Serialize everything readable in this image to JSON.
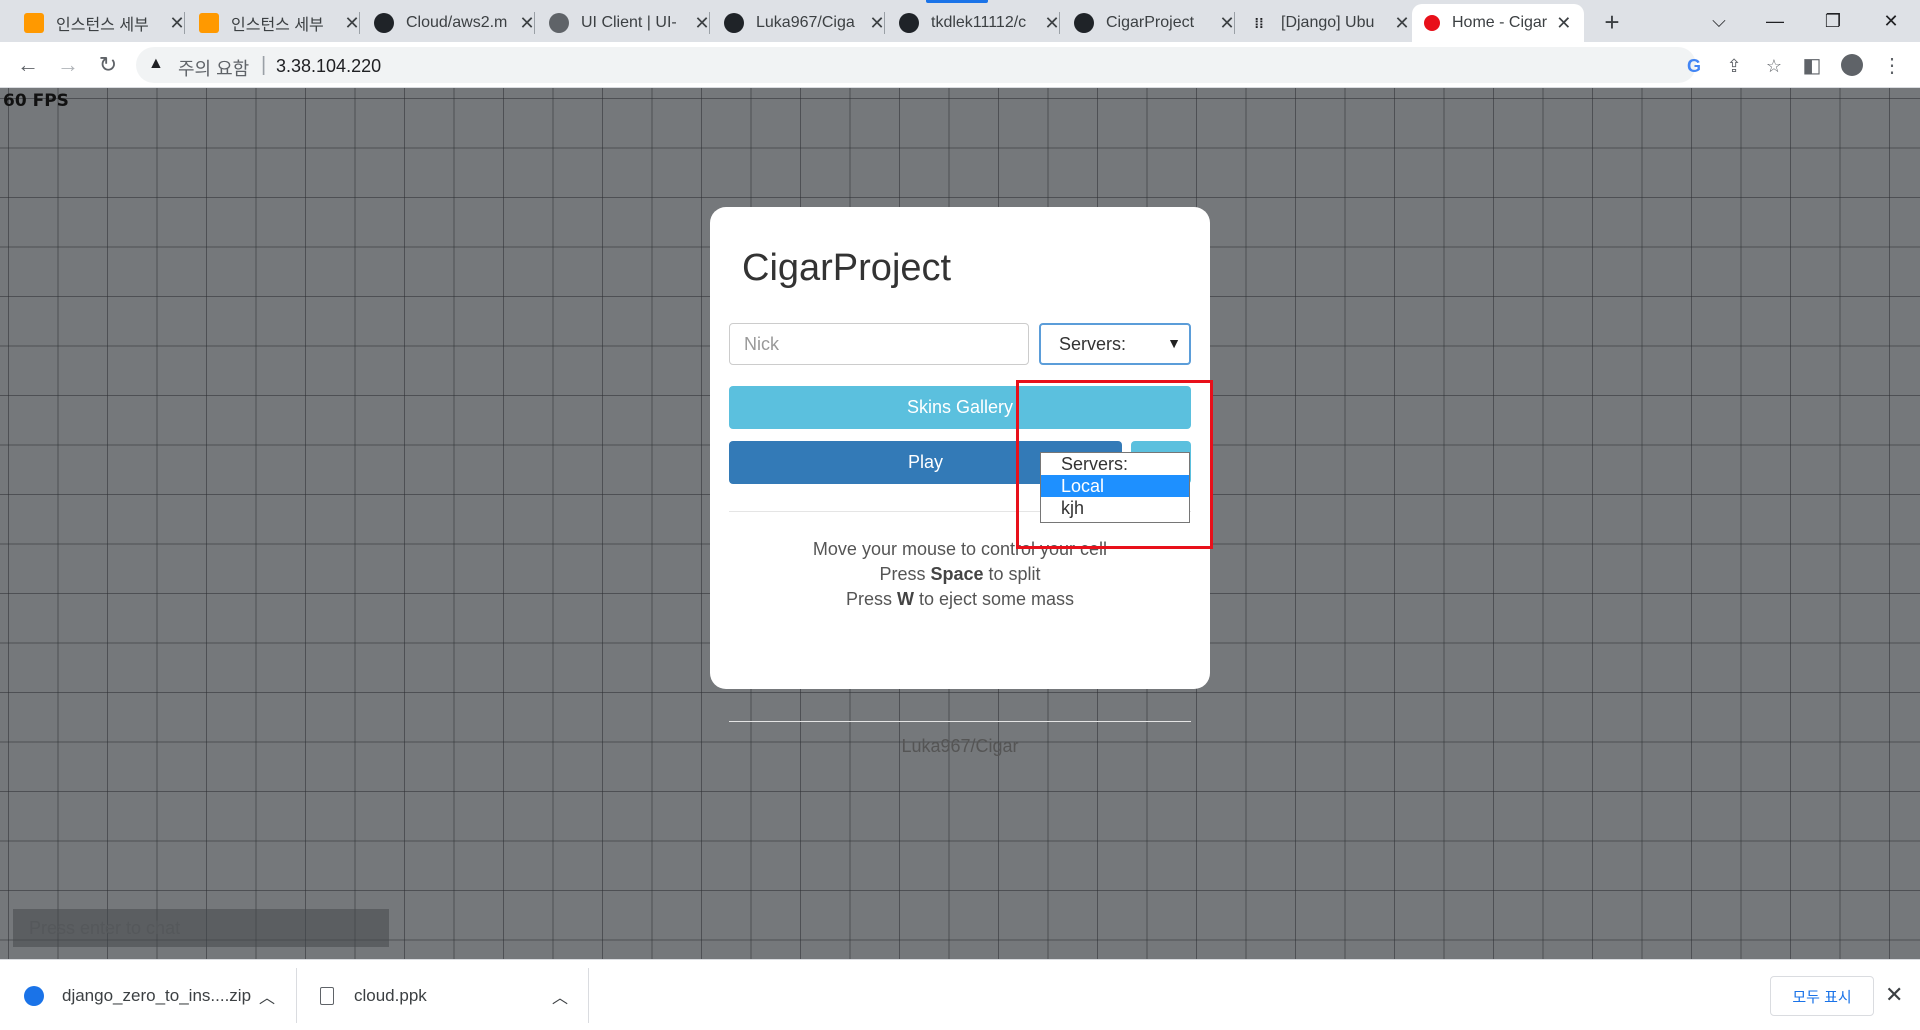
{
  "browser": {
    "tabs": [
      {
        "title": "인스턴스 세부",
        "icon": "aws-icon"
      },
      {
        "title": "인스턴스 세부",
        "icon": "aws-icon"
      },
      {
        "title": "Cloud/aws2.m",
        "icon": "github-icon"
      },
      {
        "title": "UI Client | UI-",
        "icon": "globe-icon"
      },
      {
        "title": "Luka967/Ciga",
        "icon": "github-icon"
      },
      {
        "title": "tkdlek11112/c",
        "icon": "github-icon"
      },
      {
        "title": "CigarProject",
        "icon": "github-icon"
      },
      {
        "title": "[Django] Ubu",
        "icon": "dots-icon"
      },
      {
        "title": "Home - Cigar",
        "icon": "red-circle-icon",
        "active": true
      }
    ],
    "tab_close_glyph": "✕",
    "new_tab_glyph": "+",
    "security_label": "주의 요함",
    "url": "3.38.104.220"
  },
  "page": {
    "fps": "60 FPS",
    "chat_placeholder": "Press enter to chat",
    "modal": {
      "title": "CigarProject",
      "nick_placeholder": "Nick",
      "server_select_value": "Servers:",
      "server_options": [
        "Servers:",
        "Local",
        "kjh"
      ],
      "selected_option_index": 1,
      "skins_button": "Skins Gallery",
      "play_button": "Play",
      "instructions": {
        "line1": "Move your mouse to control your cell",
        "line2_pre": "Press ",
        "line2_key": "Space",
        "line2_post": " to split",
        "line3_pre": "Press ",
        "line3_key": "W",
        "line3_post": " to eject some mass"
      },
      "footer": "Luka967/Cigar"
    }
  },
  "downloads": {
    "items": [
      {
        "name": "django_zero_to_ins....zip",
        "icon": "zip-file-icon"
      },
      {
        "name": "cloud.ppk",
        "icon": "file-icon"
      }
    ],
    "show_all_label": "모두 표시"
  },
  "colors": {
    "highlight": "#e8101a",
    "skins_button": "#5bc0de",
    "play_button": "#337ab7",
    "selected_option": "#1e90ff"
  }
}
